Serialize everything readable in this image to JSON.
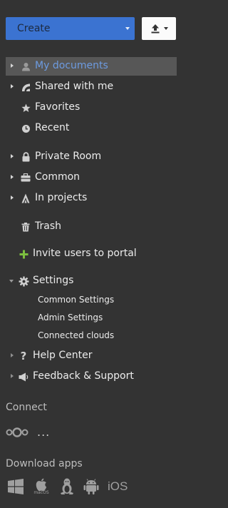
{
  "toolbar": {
    "create_label": "Create"
  },
  "nav": {
    "my_documents": "My documents",
    "shared_with_me": "Shared with me",
    "favorites": "Favorites",
    "recent": "Recent",
    "private_room": "Private Room",
    "common": "Common",
    "in_projects": "In projects",
    "trash": "Trash"
  },
  "invite_label": "Invite users to portal",
  "settings": {
    "label": "Settings",
    "items": [
      "Common Settings",
      "Admin Settings",
      "Connected clouds"
    ]
  },
  "help_center": "Help Center",
  "feedback_support": "Feedback & Support",
  "connect": {
    "title": "Connect",
    "more": "..."
  },
  "download_apps": {
    "title": "Download apps",
    "macos_label": "macOS",
    "ios_label": "iOS"
  },
  "colors": {
    "background": "#333333",
    "accent": "#3b73d1",
    "active_text": "#6d9be0",
    "invite_plus": "#7cbf3f"
  }
}
